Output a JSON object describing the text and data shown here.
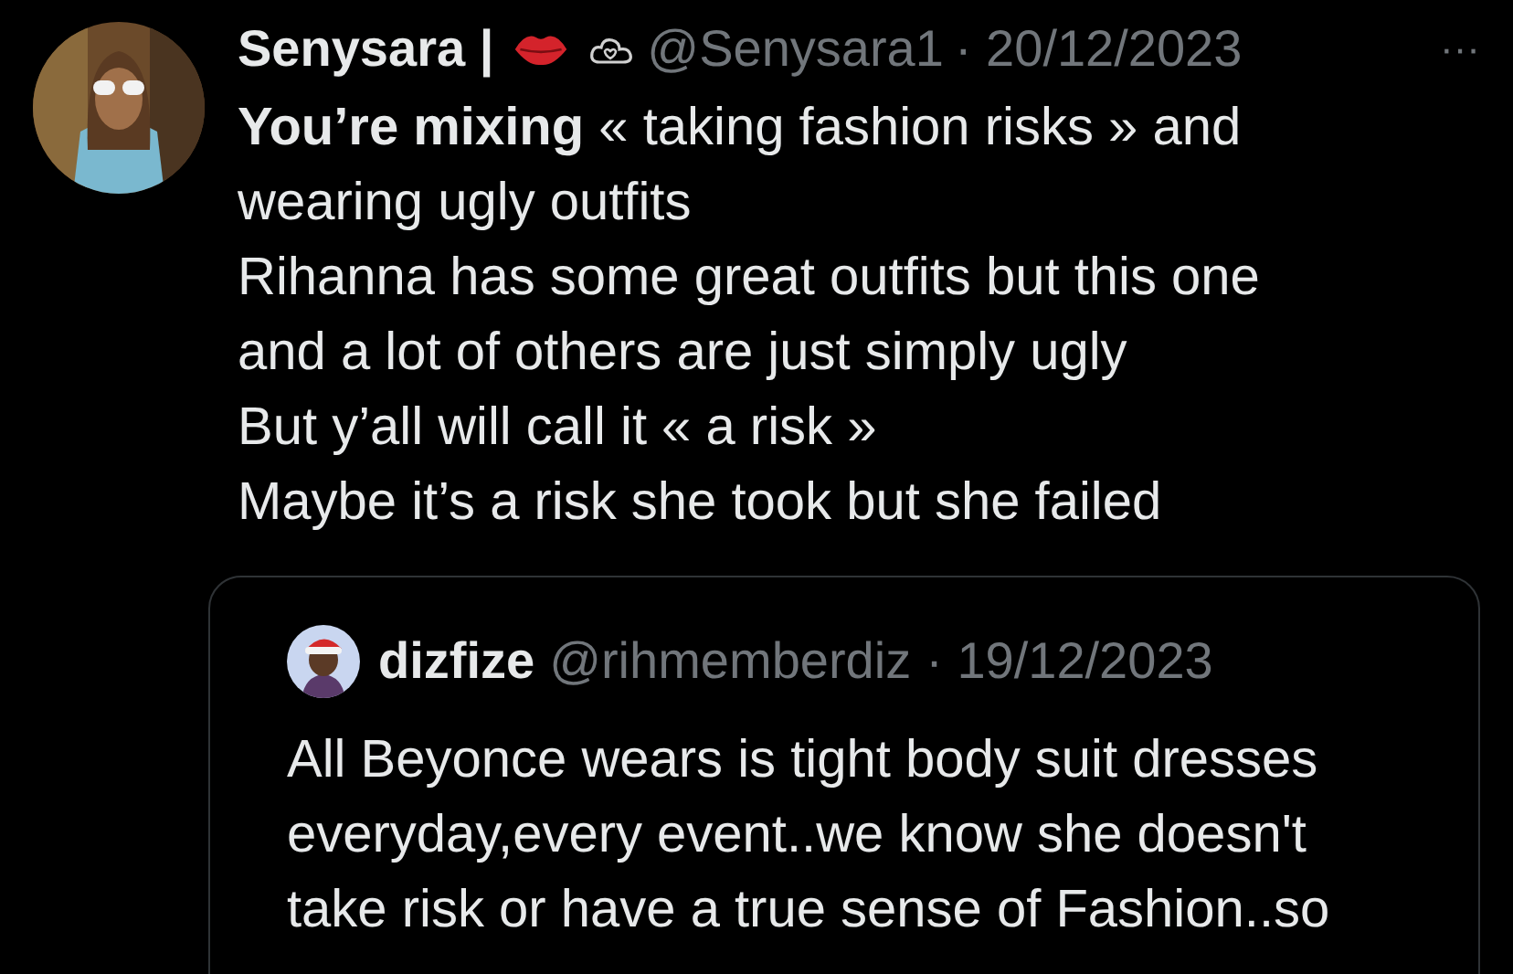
{
  "tweet": {
    "author": {
      "name": "Senysara |",
      "handle": "@Senysara1",
      "date": "· 20/12/2023"
    },
    "more": "···",
    "lines": [
      "**You’re mixing** « taking fashion risks » and",
      "wearing ugly outfits",
      "Rihanna has some great outfits but this one",
      "and a lot of others are just simply ugly",
      "But y’all will call it « a risk »",
      "Maybe it’s a risk she took but she failed"
    ],
    "quote": {
      "author": {
        "name": "dizfize",
        "handle": "@rihmemberdiz",
        "date": "· 19/12/2023"
      },
      "lines": [
        "All Beyonce wears is tight body suit dresses",
        "everyday,every event..we know she doesn't",
        "take risk or have a true sense of Fashion..so"
      ]
    }
  }
}
